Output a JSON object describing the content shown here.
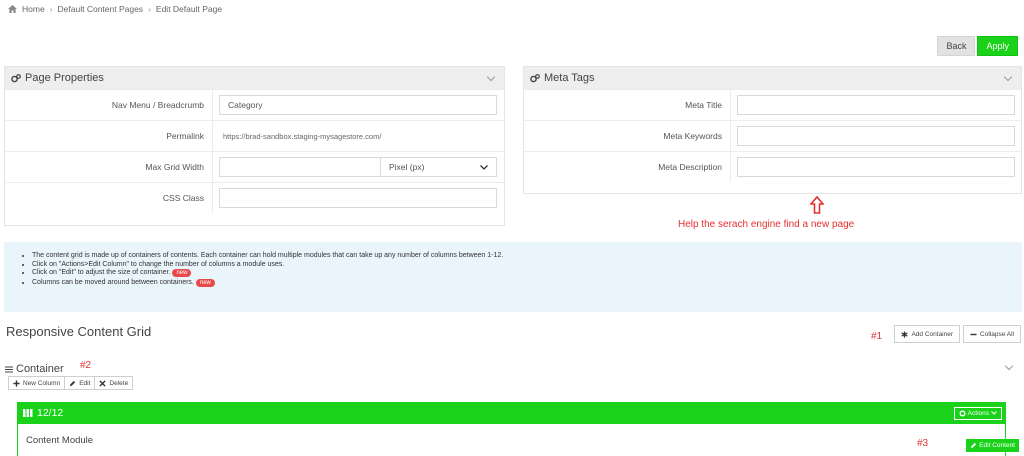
{
  "breadcrumb": {
    "home": "Home",
    "level1": "Default Content Pages",
    "level2": "Edit Default Page"
  },
  "top_actions": {
    "back": "Back",
    "apply": "Apply"
  },
  "page_properties": {
    "title": "Page Properties",
    "fields": {
      "nav_label": "Nav Menu / Breadcrumb",
      "nav_value": "Category",
      "permalink_label": "Permalink",
      "permalink_value": "https://brad-sandbox.staging-mysagestore.com/",
      "grid_label": "Max Grid Width",
      "grid_value": "",
      "grid_unit": "Pixel (px)",
      "css_label": "CSS Class",
      "css_value": ""
    }
  },
  "meta_tags": {
    "title": "Meta Tags",
    "fields": {
      "meta_title": "Meta Title",
      "meta_keywords": "Meta Keywords",
      "meta_description": "Meta Description"
    }
  },
  "annotation": {
    "help": "Help the serach engine find a new page",
    "m1": "#1",
    "m2": "#2",
    "m3": "#3"
  },
  "info": {
    "items": [
      "The content grid is made up of containers of contents. Each container can hold multiple modules that can take up any number of columns between 1-12.",
      "Click on \"Actions>Edit Column\" to change the number of columns a module uses.",
      "Click on \"Edit\" to adjust the size of container.",
      "Columns can be moved around between containers."
    ],
    "badge": "new"
  },
  "grid": {
    "title": "Responsive Content Grid",
    "add_container": "Add Container",
    "collapse_all": "Collapse All",
    "container_title": "Container",
    "new_column": "New Column",
    "edit": "Edit",
    "delete": "Delete",
    "column_label": "12/12",
    "actions": "Actions",
    "module_title": "Content Module",
    "edit_content": "Edit Content"
  },
  "colors": {
    "accent": "#19d219",
    "annotation": "#e53030",
    "info_bg": "#e9f4fb"
  }
}
